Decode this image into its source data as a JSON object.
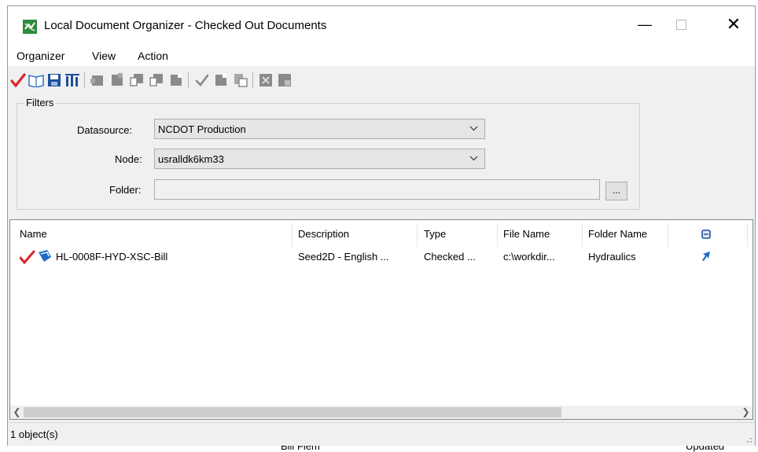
{
  "window": {
    "title": "Local Document Organizer - Checked Out Documents",
    "controls": {
      "minimize": "—",
      "close": "✕"
    }
  },
  "menu": {
    "items": [
      "Organizer",
      "View",
      "Action"
    ]
  },
  "toolbar": {
    "icons": [
      "checkmark-icon",
      "book-icon",
      "save-icon",
      "tools-icon",
      "doc-icon",
      "doc-icon",
      "doc-icon",
      "doc-icon",
      "doc-icon",
      "checkmark-icon",
      "doc-icon",
      "doc-icon",
      "doc-icon",
      "doc-icon"
    ]
  },
  "filters": {
    "legend": "Filters",
    "datasource_label": "Datasource:",
    "datasource_value": "NCDOT Production",
    "node_label": "Node:",
    "node_value": "usralldk6km33",
    "folder_label": "Folder:",
    "folder_value": "",
    "browse_label": "..."
  },
  "list": {
    "columns": [
      "Name",
      "Description",
      "Type",
      "File Name",
      "Folder Name"
    ],
    "rows": [
      {
        "name": "HL-0008F-HYD-XSC-Bill",
        "description": "Seed2D - English ...",
        "type": "Checked ...",
        "file_name": "c:\\workdir...",
        "folder_name": "Hydraulics"
      }
    ]
  },
  "status": {
    "text": "1 object(s)"
  },
  "background": {
    "left_text": "Bill Flem",
    "right_text": "Updated"
  },
  "colors": {
    "checkmark": "#d8262b",
    "accent": "#1e6ac8",
    "icon_gray": "#8a8a8a"
  }
}
